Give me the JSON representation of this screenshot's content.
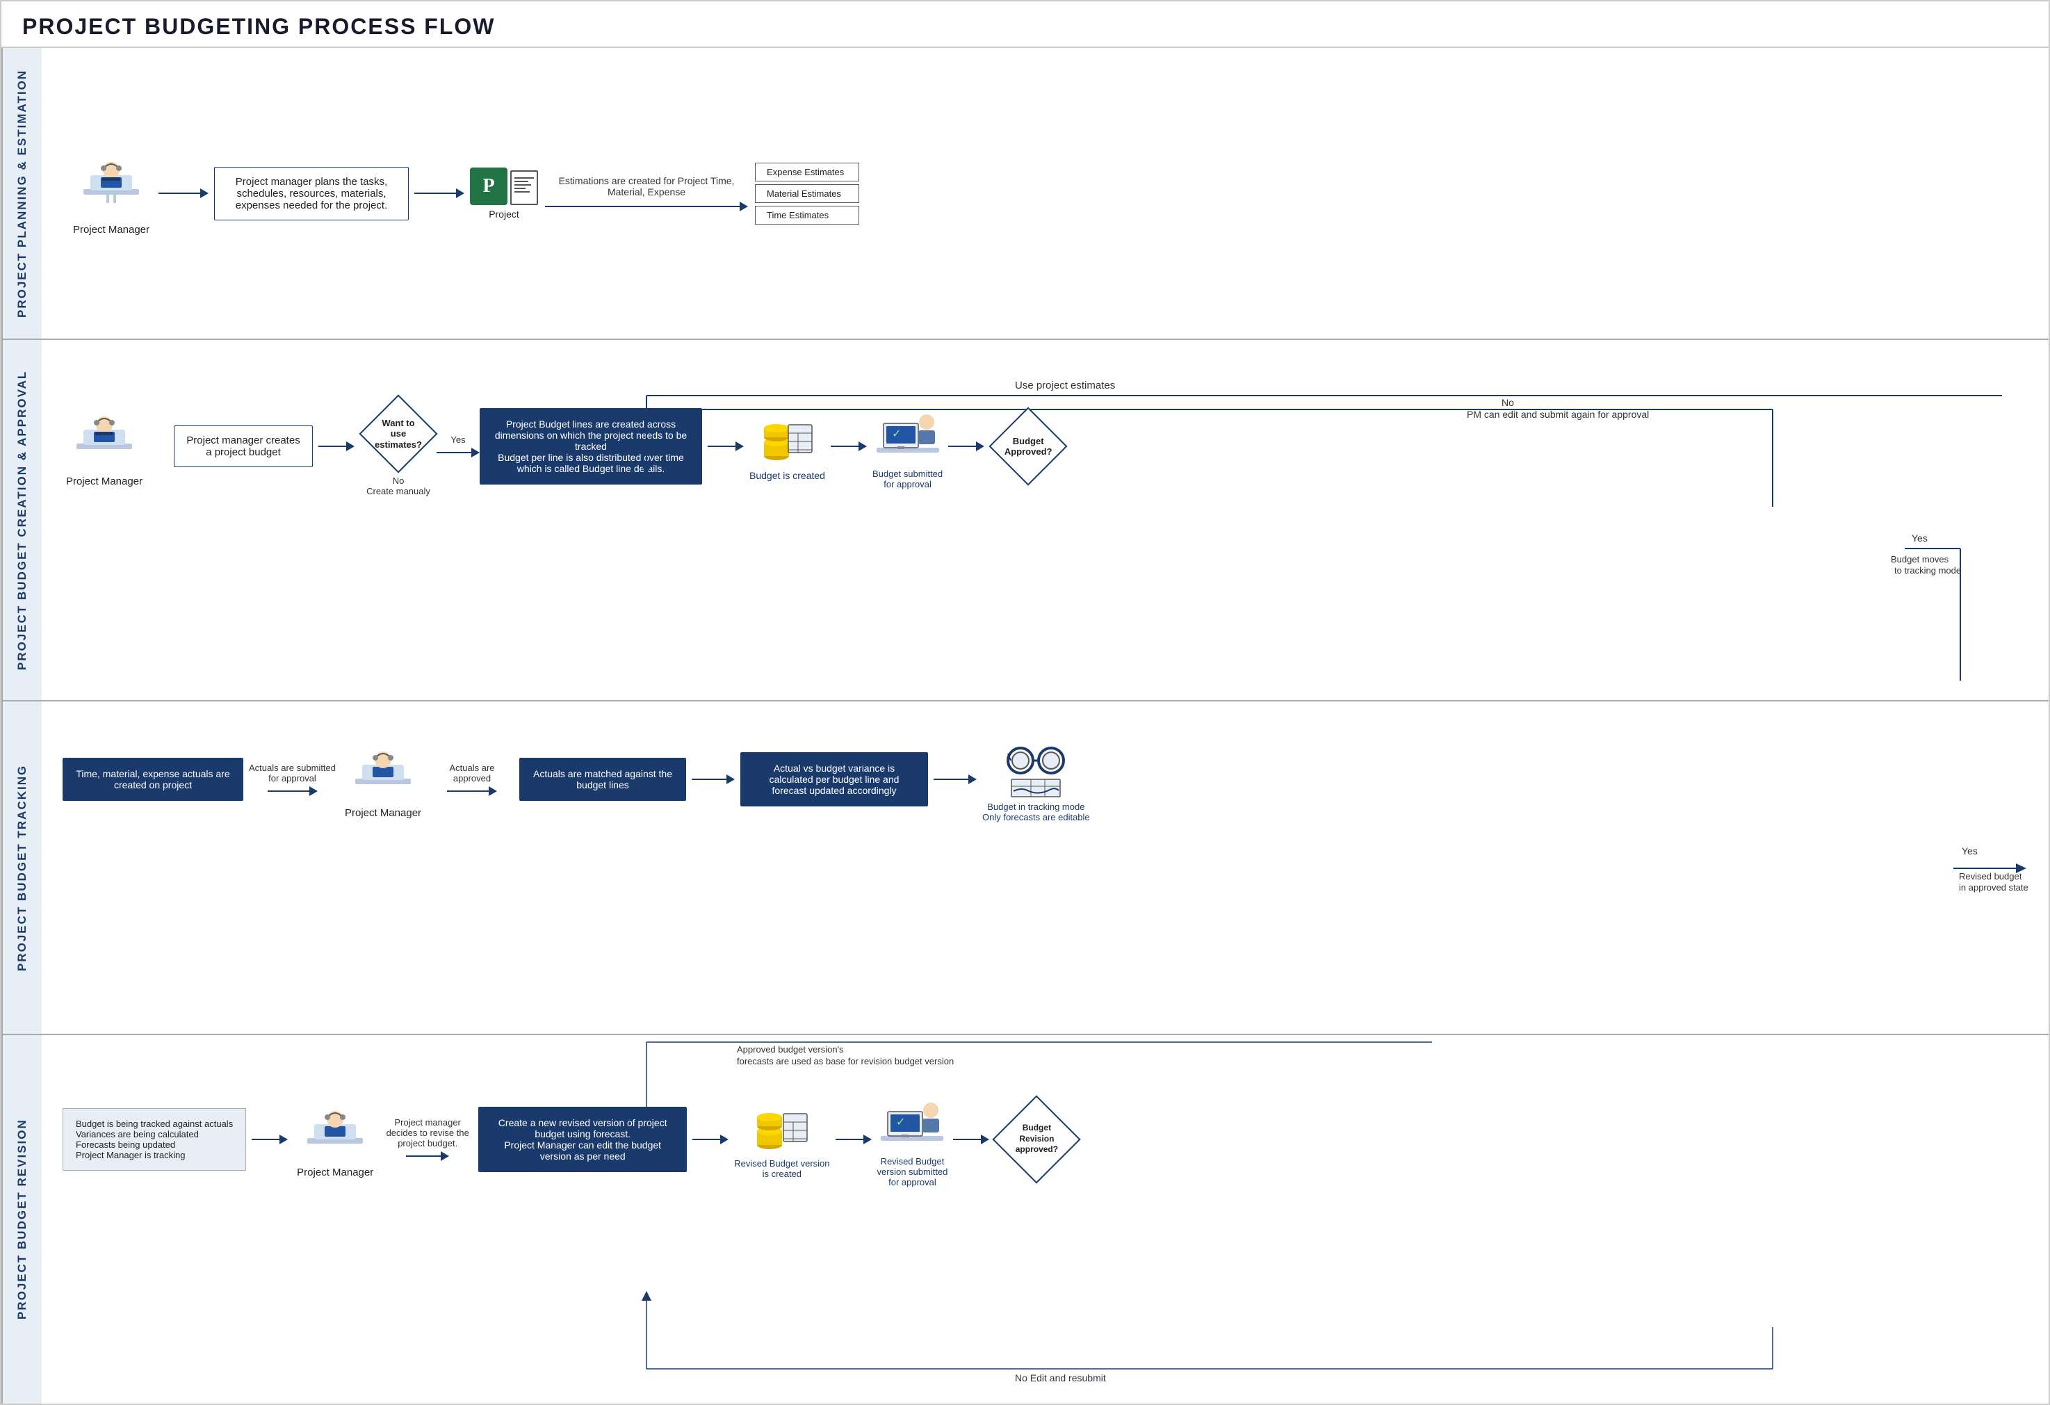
{
  "title": "PROJECT BUDGETING PROCESS FLOW",
  "lanes": [
    {
      "id": "lane1",
      "label": "PROJECT PLANNING & ESTIMATION",
      "actor": "Project Manager",
      "flow": [
        {
          "type": "actor",
          "label": "Project Manager"
        },
        {
          "type": "arrow",
          "label": ""
        },
        {
          "type": "text-box",
          "text": "Project manager plans the tasks, schedules, resources, materials, expenses needed for the project.",
          "dark": false
        },
        {
          "type": "arrow",
          "label": ""
        },
        {
          "type": "project-icon"
        },
        {
          "type": "arrow",
          "text": "Estimations are created for Project Time, Material, Expense"
        },
        {
          "type": "stacked-docs",
          "items": [
            "Expense Estimates",
            "Material Estimates",
            "Time Estimates"
          ]
        }
      ]
    },
    {
      "id": "lane2",
      "label": "PROJECT BUDGET CREATION & APPROVAL",
      "flow": [
        {
          "type": "actor",
          "label": "Project Manager"
        },
        {
          "type": "text-box",
          "text": "Project manager creates a project budget"
        },
        {
          "type": "diamond",
          "text": "Want to use estimates?"
        },
        {
          "type": "yes-branch",
          "text": "Yes"
        },
        {
          "type": "process-dark",
          "text": "Project Budget lines are created across dimensions on which the project needs to be tracked\nBudget per line is also distributed over time which is called Budget line details."
        },
        {
          "type": "budget-icon",
          "label": "Budget is created"
        },
        {
          "type": "person-approval",
          "label": "Budget submitted for approval"
        },
        {
          "type": "diamond",
          "text": "Budget Approved?"
        },
        {
          "type": "yes-label",
          "text": "Yes\nBudget moves to tracking mode"
        },
        {
          "type": "no-label",
          "text": "No\nPM can edit and submit again for approval"
        }
      ]
    },
    {
      "id": "lane3",
      "label": "PROJECT BUDGET TRACKING",
      "flow": [
        {
          "type": "dark-box",
          "text": "Time, material, expense actuals are created on project"
        },
        {
          "type": "arrow",
          "label": "Actuals are submitted for approval"
        },
        {
          "type": "actor",
          "label": "Project Manager"
        },
        {
          "type": "arrow",
          "label": "Actuals are approved"
        },
        {
          "type": "dark-box",
          "text": "Actuals are matched against the budget lines"
        },
        {
          "type": "arrow",
          "label": ""
        },
        {
          "type": "dark-box",
          "text": "Actual vs budget variance is calculated per budget line and forecast updated accordingly"
        },
        {
          "type": "arrow",
          "label": ""
        },
        {
          "type": "tracking-icon",
          "label": "Budget in tracking mode\nOnly forecasts are editable"
        },
        {
          "type": "yes-arrow",
          "text": "Yes\nRevised budget in approved state"
        }
      ]
    },
    {
      "id": "lane4",
      "label": "PROJECT BUDGET REVISION",
      "flow": [
        {
          "type": "light-box",
          "text": "Budget is being tracked against actuals\nVariances are being calculated\nForecasts being updated\nProject Manager is tracking"
        },
        {
          "type": "arrow",
          "label": ""
        },
        {
          "type": "actor",
          "label": "Project Manager"
        },
        {
          "type": "arrow",
          "label": "Project manager decides to revise the project budget."
        },
        {
          "type": "dark-box",
          "text": "Create a new revised version of project budget using forecast.\nProject Manager can edit the budget version as per need"
        },
        {
          "type": "rev-budget-icon",
          "label": "Revised Budget version is created"
        },
        {
          "type": "person-approval2",
          "label": "Revised Budget version submitted for approval"
        },
        {
          "type": "diamond2",
          "text": "Budget Revision approved?"
        },
        {
          "type": "no-edit-resubmit",
          "text": "No Edit and resubmit"
        },
        {
          "type": "top-note",
          "text": "Approved budget version's forecasts are used as base for revision budget version"
        }
      ]
    }
  ],
  "icons": {
    "actor": "🧑‍💼",
    "project": "📋",
    "budget": "🗃️",
    "person_desk": "👩‍💼",
    "tracking": "🔍",
    "revised": "📊",
    "coins": "💰",
    "calculator": "🧮",
    "glasses": "🔭"
  },
  "colors": {
    "dark_blue": "#1a3a6b",
    "light_blue_bg": "#e8eef5",
    "border": "#aaa",
    "accent": "#2255a4",
    "white": "#ffffff",
    "text_dark": "#222222",
    "text_medium": "#444444"
  }
}
